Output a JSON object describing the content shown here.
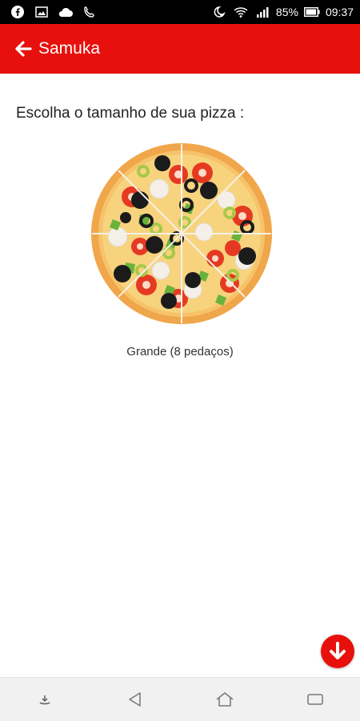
{
  "status_bar": {
    "left_icons": [
      "facebook-icon",
      "image-icon",
      "cloud-icon",
      "missed-call-icon"
    ],
    "right_icons": [
      "do-not-disturb-icon",
      "wifi-icon",
      "signal-icon"
    ],
    "battery": "85%",
    "time": "09:37"
  },
  "app_bar": {
    "title": "Samuka",
    "color": "#e8100d"
  },
  "main": {
    "prompt": "Escolha o tamanho de sua pizza :",
    "pizza_caption": "Grande (8 pedaços)"
  },
  "fab": {
    "icon": "arrow-down-icon"
  },
  "nav_bar": {
    "items": [
      "download-icon",
      "back-triangle-icon",
      "home-icon",
      "recents-icon"
    ]
  }
}
